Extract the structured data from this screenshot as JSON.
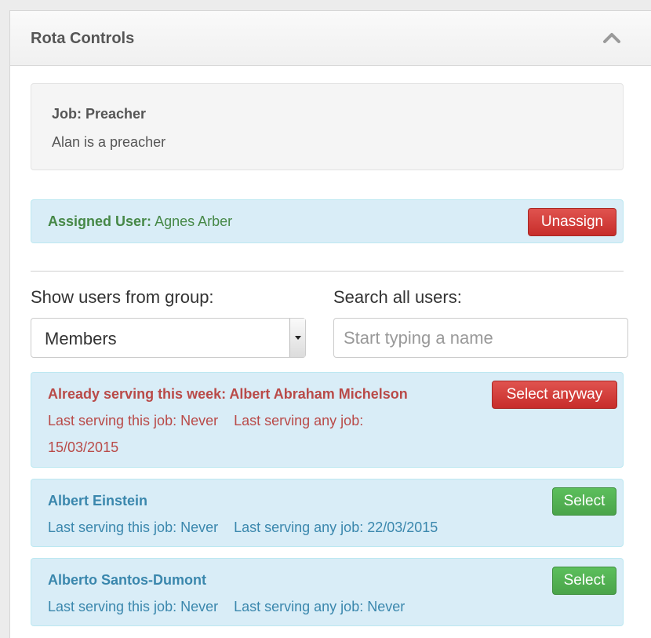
{
  "panel": {
    "title": "Rota Controls",
    "collapse_icon": "chevron-up-icon"
  },
  "job": {
    "title": "Job: Preacher",
    "description": "Alan is a preacher"
  },
  "assigned": {
    "label": "Assigned User:",
    "user": "Agnes Arber",
    "unassign_label": "Unassign"
  },
  "filters": {
    "group_label": "Show users from group:",
    "group_selected": "Members",
    "search_label": "Search all users:",
    "search_placeholder": "Start typing a name"
  },
  "users": [
    {
      "name": "Already serving this week: Albert Abraham Michelson",
      "last_this_job": "Last serving this job: Never",
      "last_any_job": "Last serving any job:",
      "last_any_job_date": "15/03/2015",
      "button_label": "Select anyway"
    },
    {
      "name": "Albert Einstein",
      "last_this_job": "Last serving this job: Never",
      "last_any_job": "Last serving any job: 22/03/2015",
      "button_label": "Select"
    },
    {
      "name": "Alberto Santos-Dumont",
      "last_this_job": "Last serving this job: Never",
      "last_any_job": "Last serving any job: Never",
      "button_label": "Select"
    }
  ],
  "colors": {
    "danger": "#c9302c",
    "success": "#4cae4c",
    "info_bg": "#d9edf7",
    "assigned_text": "#468847",
    "warning_text": "#b94a48",
    "info_text": "#3a87ad"
  }
}
